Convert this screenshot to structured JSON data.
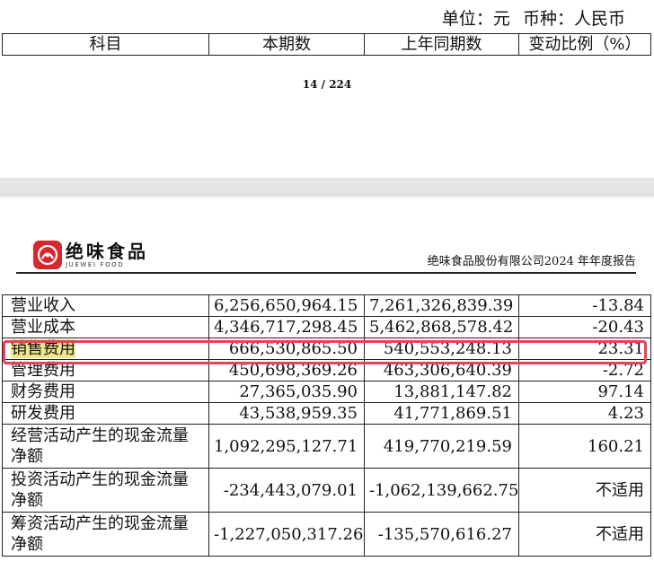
{
  "top_section": {
    "unit_label": "单位：元",
    "currency_label": "币种：人民币",
    "headers": [
      "科目",
      "本期数",
      "上年同期数",
      "变动比例（%）"
    ],
    "page_number": "14 / 224"
  },
  "header": {
    "logo_cn": "绝味食品",
    "logo_en": "JUEWEI FOOD",
    "report_title": "绝味食品股份有限公司2024 年年度报告"
  },
  "rows": [
    {
      "item": "营业收入",
      "current": "6,256,650,964.15",
      "prior": "7,261,326,839.39",
      "change": "-13.84"
    },
    {
      "item": "营业成本",
      "current": "4,346,717,298.45",
      "prior": "5,462,868,578.42",
      "change": "-20.43"
    },
    {
      "item": "销售费用",
      "current": "666,530,865.50",
      "prior": "540,553,248.13",
      "change": "23.31"
    },
    {
      "item": "管理费用",
      "current": "450,698,369.26",
      "prior": "463,306,640.39",
      "change": "-2.72"
    },
    {
      "item": "财务费用",
      "current": "27,365,035.90",
      "prior": "13,881,147.82",
      "change": "97.14"
    },
    {
      "item": "研发费用",
      "current": "43,538,959.35",
      "prior": "41,771,869.51",
      "change": "4.23"
    },
    {
      "item": "经营活动产生的现金流量净额",
      "current": "1,092,295,127.71",
      "prior": "419,770,219.59",
      "change": "160.21"
    },
    {
      "item": "投资活动产生的现金流量净额",
      "current": "-234,443,079.01",
      "prior": "-1,062,139,662.75",
      "change": "不适用"
    },
    {
      "item": "筹资活动产生的现金流量净额",
      "current": "-1,227,050,317.26",
      "prior": "-135,570,616.27",
      "change": "不适用"
    }
  ],
  "colors": {
    "highlight_box": "#e8415a",
    "text_highlight": "#f0e58a",
    "logo_red": "#d7282f"
  }
}
